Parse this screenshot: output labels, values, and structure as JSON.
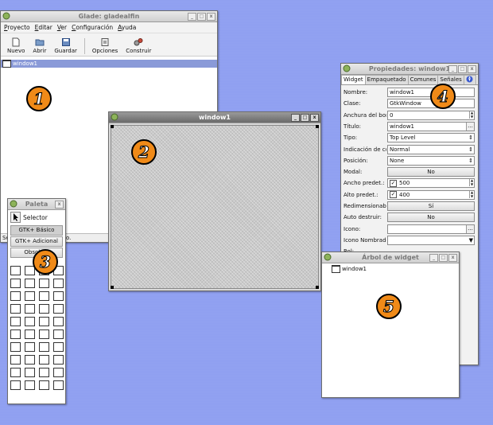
{
  "glade": {
    "title": "Glade: gladealfin",
    "menu": [
      "Proyecto",
      "Editar",
      "Ver",
      "Configuración",
      "Ayuda"
    ],
    "toolbar": {
      "new": "Nuevo",
      "open": "Abrir",
      "save": "Guardar",
      "options": "Opciones",
      "build": "Construir"
    },
    "tree_item": "window1",
    "status": "Se",
    "status_tail": "o."
  },
  "window1": {
    "title": "window1"
  },
  "palette": {
    "title": "Paleta",
    "selector": "Selector",
    "groups": [
      "GTK+ Básico",
      "GTK+ Adicional",
      "Obsoleto"
    ],
    "icons": [
      [
        "menu-icon",
        "toolbar-icon",
        "handlebox-icon",
        "label-icon"
      ],
      [
        "label-icon",
        "entry-icon",
        "combo-icon",
        "spinbutton-icon"
      ],
      [
        "text-label-icon",
        "entry-field-icon",
        "text-view-icon",
        "list-icon"
      ],
      [
        "button-icon",
        "toggle-icon",
        "check-icon",
        "radio-icon"
      ],
      [
        "option-menu-icon",
        "menu-button-icon",
        "table-icon",
        "grid-icon"
      ],
      [
        "separator-icon",
        "vseparator-icon",
        "image-icon",
        "drawing-icon"
      ],
      [
        "frame-icon",
        "image-frame-icon",
        "scroll-icon",
        "calendar-icon"
      ],
      [
        "vbox-icon",
        "hbox-icon",
        "table-layout-icon",
        "fixed-icon"
      ],
      [
        "hscale-icon",
        "vscale-icon",
        "hpaned-icon",
        "vpaned-icon"
      ],
      [
        "notebook-icon",
        "notebook2-icon",
        "dialog-icon",
        "progress-icon"
      ]
    ]
  },
  "properties": {
    "title": "Propiedades: window1",
    "tabs": [
      "Widget",
      "Empaquetado",
      "Comunes",
      "Señales"
    ],
    "rows": [
      {
        "label": "Nombre:",
        "value": "window1",
        "kind": "text"
      },
      {
        "label": "Clase:",
        "value": "GtkWindow",
        "kind": "text"
      },
      {
        "label": "Anchura del bor",
        "value": "0",
        "kind": "spin"
      },
      {
        "label": "Título:",
        "value": "window1",
        "kind": "ellipsis"
      },
      {
        "label": "Tipo:",
        "value": "Top Level",
        "kind": "combo"
      },
      {
        "label": "Indicación de co",
        "value": "Normal",
        "kind": "combo"
      },
      {
        "label": "Posición:",
        "value": "None",
        "kind": "combo"
      },
      {
        "label": "Modal:",
        "value": "No",
        "kind": "button"
      },
      {
        "label": "Ancho predet.:",
        "value": "500",
        "kind": "checkspin"
      },
      {
        "label": "Alto predet.:",
        "value": "400",
        "kind": "checkspin"
      },
      {
        "label": "Redimensionabl",
        "value": "Sí",
        "kind": "button"
      },
      {
        "label": "Auto destruir:",
        "value": "No",
        "kind": "button"
      },
      {
        "label": "Icono:",
        "value": "",
        "kind": "ellipsis"
      },
      {
        "label": "Icono Nombrado",
        "value": "",
        "kind": "dropdown"
      },
      {
        "label": "Rol:",
        "value": "",
        "kind": "plain"
      }
    ]
  },
  "widget_tree": {
    "title": "Árbol de widget",
    "item": "window1"
  },
  "badges": [
    "1",
    "2",
    "3",
    "4",
    "5"
  ]
}
